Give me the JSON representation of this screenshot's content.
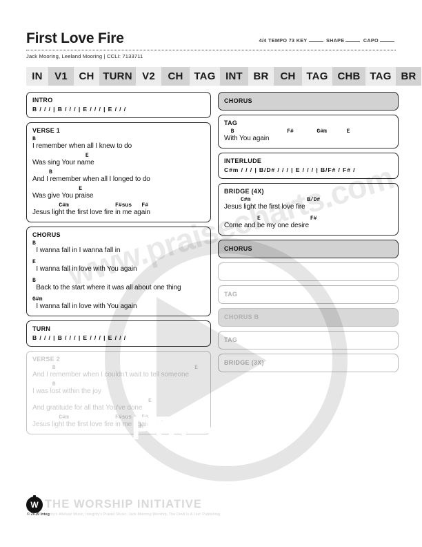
{
  "header": {
    "title": "First Love Fire",
    "meta_time": "4/4",
    "meta_tempo_label": "TEMPO",
    "meta_tempo": "73",
    "meta_key_label": "KEY",
    "meta_shape_label": "SHAPE",
    "meta_capo_label": "CAPO",
    "credits": "Jack Mooring, Leeland Mooring | CCLI: 7133711"
  },
  "nav": {
    "pills": [
      {
        "label": "IN",
        "shade": "light"
      },
      {
        "label": "V1",
        "shade": "dark"
      },
      {
        "label": "CH",
        "shade": "light"
      },
      {
        "label": "TURN",
        "shade": "dark"
      },
      {
        "label": "V2",
        "shade": "light"
      },
      {
        "label": "CH",
        "shade": "dark"
      },
      {
        "label": "TAG",
        "shade": "light"
      },
      {
        "label": "INT",
        "shade": "dark"
      },
      {
        "label": "BR",
        "shade": "light"
      },
      {
        "label": "CH",
        "shade": "dark"
      },
      {
        "label": "TAG",
        "shade": "light"
      },
      {
        "label": "CHB",
        "shade": "dark"
      },
      {
        "label": "TAG",
        "shade": "light"
      },
      {
        "label": "BR",
        "shade": "dark"
      }
    ]
  },
  "left_column": {
    "intro": {
      "label": "INTRO",
      "progression": "B / / / | B / / / | E / / / | E / / /"
    },
    "verse1": {
      "label": "VERSE 1",
      "lines": [
        {
          "chords": "B",
          "lyrics": "I remember when all I knew to do"
        },
        {
          "chords": "                E",
          "lyrics": "Was sing Your name"
        },
        {
          "chords": "     B",
          "lyrics": "And I remember when all I longed to do"
        },
        {
          "chords": "              E",
          "lyrics": "Was give You praise"
        },
        {
          "chords": "        C#m              F#sus   F#",
          "lyrics": "Jesus light the first love fire in me again"
        }
      ]
    },
    "chorus": {
      "label": "CHORUS",
      "lines": [
        {
          "chords": "B",
          "lyrics": "  I wanna fall in I wanna fall in"
        },
        {
          "chords": "E",
          "lyrics": "  I wanna fall in love with You again"
        },
        {
          "chords": "B",
          "lyrics": "  Back to the start where it was all about one thing"
        },
        {
          "chords": "G#m",
          "lyrics": "  I wanna fall in love with You again"
        }
      ]
    },
    "turn": {
      "label": "TURN",
      "progression": "B / / / | B / / / | E / / / | E / / /"
    },
    "verse2": {
      "label": "VERSE 2",
      "lines": [
        {
          "chords": "      B                                          E",
          "lyrics": "And I remember when I couldn't wait to tell someone"
        },
        {
          "chords": "      B",
          "lyrics": "I was lost within the joy"
        },
        {
          "chords": "                                   E",
          "lyrics": "And gratitude for all that You've done"
        },
        {
          "chords": "        C#m              F#sus   F#",
          "lyrics": "Jesus light the first love fire in me again"
        }
      ]
    }
  },
  "right_column": {
    "chorus_ref": {
      "label": "CHORUS"
    },
    "tag": {
      "label": "TAG",
      "lines": [
        {
          "chords": "  B                F#       G#m      E",
          "lyrics": "With You again"
        }
      ]
    },
    "interlude": {
      "label": "INTERLUDE",
      "progression": "C#m / / / | B/D# / / / | E / / / | B/F# / F# /"
    },
    "bridge": {
      "label": "BRIDGE (4X)",
      "lines": [
        {
          "chords": "     C#m                 B/D#",
          "lyrics": "Jesus light the first love fire"
        },
        {
          "chords": "          E               F#",
          "lyrics": "Come and be my one desire"
        }
      ]
    },
    "chorus_ref2": {
      "label": "CHORUS"
    },
    "ghost_boxes": [
      {
        "label": "",
        "shaded": false
      },
      {
        "label": "TAG",
        "shaded": false
      },
      {
        "label": "CHORUS B",
        "shaded": true
      },
      {
        "label": "TAG",
        "shaded": false
      },
      {
        "label": "BRIDGE (3X)",
        "shaded": false
      }
    ]
  },
  "overlay": {
    "preview_label": "PREVIEW",
    "watermark": "www.praisecharts.com"
  },
  "footer": {
    "brand": "THE WORSHIP INITIATIVE",
    "logo_letter": "W",
    "copyright_mark": "© 2019 Integ",
    "copyright_rest": "rity's Alleluia! Music, Integrity's Praise! Music, Jack Mooring Worship, The Devil Is A Liar! Publishing"
  },
  "colors": {
    "pill_light": "#ececec",
    "pill_dark": "#d2d2d2",
    "box_border": "#2b2b2b",
    "text": "#111111",
    "faded_text": "#c9c9c9"
  }
}
